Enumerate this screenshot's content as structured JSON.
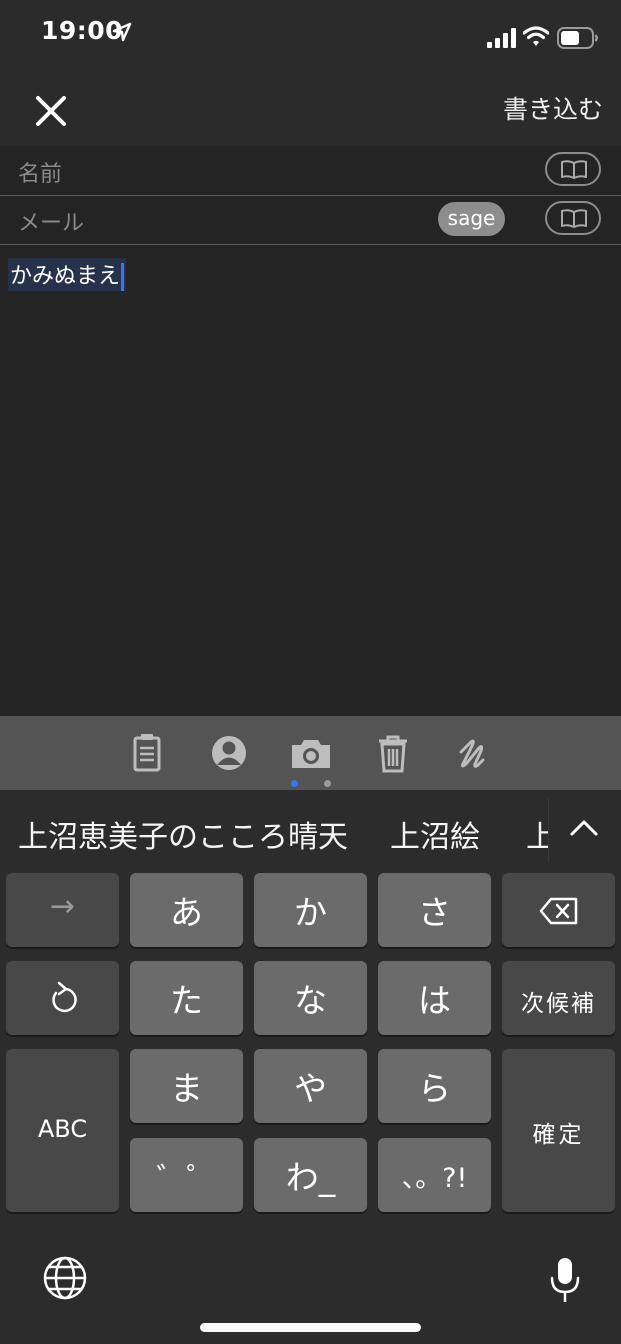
{
  "status_bar": {
    "time": "19:00"
  },
  "nav": {
    "submit_label": "書き込む"
  },
  "form": {
    "name_placeholder": "名前",
    "mail_placeholder": "メール",
    "sage_label": "sage",
    "body_value": "かみぬまえ"
  },
  "toolbar": {
    "icons": [
      "clipboard-icon",
      "person-icon",
      "camera-icon",
      "trash-icon",
      "draw-icon"
    ],
    "page_count": 2,
    "active_page": 0
  },
  "keyboard": {
    "candidates": [
      "上沼恵美子のこころ晴天",
      "上沼絵",
      "上"
    ],
    "keys": {
      "arrow": "→",
      "a": "あ",
      "ka": "か",
      "sa": "さ",
      "ta": "た",
      "na": "な",
      "ha": "は",
      "ma": "ま",
      "ya": "や",
      "ra": "ら",
      "dakuten": "゛゜",
      "wa": "わ_",
      "punct": "、。?!",
      "abc": "ABC",
      "next_candidate": "次候補",
      "confirm": "確定"
    }
  },
  "colors": {
    "accent": "#3478f6",
    "background": "#242424"
  }
}
